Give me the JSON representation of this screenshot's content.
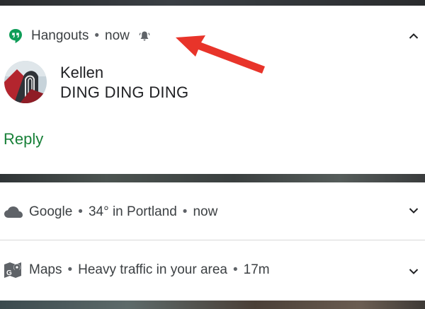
{
  "notifications": {
    "hangouts": {
      "app": "Hangouts",
      "separator": "•",
      "time": "now",
      "icon": "hangouts-icon",
      "accent": "#0f9d58",
      "sender": "Kellen",
      "message": "DING DING DING",
      "action": "Reply",
      "action_color": "#188038",
      "status_icon": "alert-bell-icon",
      "expand_icon": "chevron-up-icon"
    },
    "google": {
      "app": "Google",
      "separator": "•",
      "detail": "34° in Portland",
      "time": "now",
      "icon": "cloud-icon",
      "expand_icon": "chevron-down-icon"
    },
    "maps": {
      "app": "Maps",
      "separator": "•",
      "detail": "Heavy traffic in your area",
      "time": "17m",
      "icon": "maps-icon",
      "expand_icon": "chevron-down-icon"
    }
  },
  "annotation": {
    "icon": "red-arrow-icon",
    "color": "#e8342a"
  }
}
